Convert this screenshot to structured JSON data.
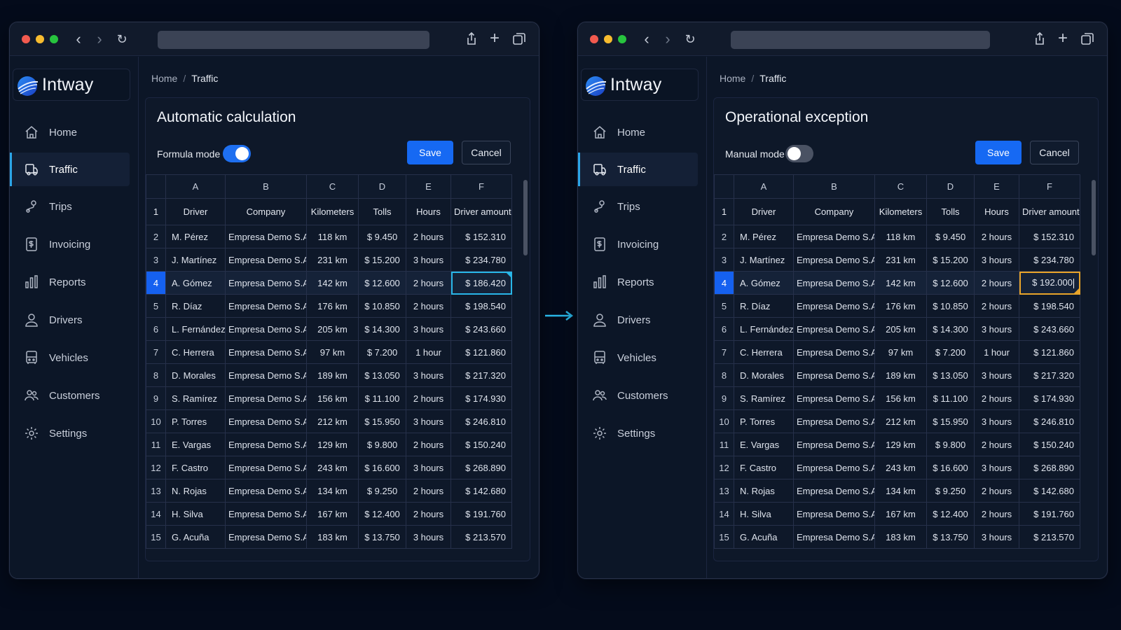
{
  "windows": [
    {
      "id": "left",
      "brand": "Intway",
      "breadcrumb": {
        "home": "Home",
        "current": "Traffic"
      },
      "menu": [
        {
          "label": "Home",
          "icon": "home-icon",
          "active": false
        },
        {
          "label": "Traffic",
          "icon": "truck-icon",
          "active": true
        },
        {
          "label": "Trips",
          "icon": "route-icon",
          "active": false
        },
        {
          "label": "Invoicing",
          "icon": "invoice-icon",
          "active": false
        },
        {
          "label": "Reports",
          "icon": "bar-chart-icon",
          "active": false
        },
        {
          "label": "Drivers",
          "icon": "user-icon",
          "active": false
        },
        {
          "label": "Vehicles",
          "icon": "vehicle-icon",
          "active": false
        },
        {
          "label": "Customers",
          "icon": "users-icon",
          "active": false
        },
        {
          "label": "Settings",
          "icon": "gear-icon",
          "active": false
        }
      ],
      "panel": {
        "title": "Automatic calculation",
        "mode_label": "Formula mode",
        "mode_on": true,
        "save_label": "Save",
        "cancel_label": "Cancel"
      },
      "sheet": {
        "columns": [
          "A",
          "B",
          "C",
          "D",
          "E",
          "F"
        ],
        "header_row_number": "1",
        "headers": [
          "Driver",
          "Company",
          "Kilometers",
          "Tolls",
          "Hours",
          "Driver amount"
        ],
        "active_row": 4,
        "rows": [
          {
            "n": "2",
            "driver": "M. Pérez",
            "company": "Empresa Demo S.A.",
            "km": "118 km",
            "tolls": "$ 9.450",
            "hours": "2 hours",
            "amount": "$ 152.310"
          },
          {
            "n": "3",
            "driver": "J. Martínez",
            "company": "Empresa Demo S.A.",
            "km": "231 km",
            "tolls": "$ 15.200",
            "hours": "3 hours",
            "amount": "$ 234.780"
          },
          {
            "n": "4",
            "driver": "A. Gómez",
            "company": "Empresa Demo S.A.",
            "km": "142 km",
            "tolls": "$ 12.600",
            "hours": "2 hours",
            "amount": "$ 186.420"
          },
          {
            "n": "5",
            "driver": "R. Díaz",
            "company": "Empresa Demo S.A.",
            "km": "176 km",
            "tolls": "$ 10.850",
            "hours": "2 hours",
            "amount": "$ 198.540"
          },
          {
            "n": "6",
            "driver": "L. Fernández",
            "company": "Empresa Demo S.A.",
            "km": "205 km",
            "tolls": "$ 14.300",
            "hours": "3 hours",
            "amount": "$ 243.660"
          },
          {
            "n": "7",
            "driver": "C. Herrera",
            "company": "Empresa Demo S.A.",
            "km": "97 km",
            "tolls": "$ 7.200",
            "hours": "1 hour",
            "amount": "$ 121.860"
          },
          {
            "n": "8",
            "driver": "D. Morales",
            "company": "Empresa Demo S.A.",
            "km": "189 km",
            "tolls": "$ 13.050",
            "hours": "3 hours",
            "amount": "$ 217.320"
          },
          {
            "n": "9",
            "driver": "S. Ramírez",
            "company": "Empresa Demo S.A.",
            "km": "156 km",
            "tolls": "$ 11.100",
            "hours": "2 hours",
            "amount": "$ 174.930"
          },
          {
            "n": "10",
            "driver": "P. Torres",
            "company": "Empresa Demo S.A.",
            "km": "212 km",
            "tolls": "$ 15.950",
            "hours": "3 hours",
            "amount": "$ 246.810"
          },
          {
            "n": "11",
            "driver": "E. Vargas",
            "company": "Empresa Demo S.A.",
            "km": "129 km",
            "tolls": "$ 9.800",
            "hours": "2 hours",
            "amount": "$ 150.240"
          },
          {
            "n": "12",
            "driver": "F. Castro",
            "company": "Empresa Demo S.A.",
            "km": "243 km",
            "tolls": "$ 16.600",
            "hours": "3 hours",
            "amount": "$ 268.890"
          },
          {
            "n": "13",
            "driver": "N. Rojas",
            "company": "Empresa Demo S.A.",
            "km": "134 km",
            "tolls": "$ 9.250",
            "hours": "2 hours",
            "amount": "$ 142.680"
          },
          {
            "n": "14",
            "driver": "H. Silva",
            "company": "Empresa Demo S.A.",
            "km": "167 km",
            "tolls": "$ 12.400",
            "hours": "2 hours",
            "amount": "$ 191.760"
          },
          {
            "n": "15",
            "driver": "G. Acuña",
            "company": "Empresa Demo S.A.",
            "km": "183 km",
            "tolls": "$ 13.750",
            "hours": "3 hours",
            "amount": "$ 213.570"
          }
        ]
      }
    },
    {
      "id": "right",
      "brand": "Intway",
      "breadcrumb": {
        "home": "Home",
        "current": "Traffic"
      },
      "menu": [
        {
          "label": "Home",
          "icon": "home-icon",
          "active": false
        },
        {
          "label": "Traffic",
          "icon": "truck-icon",
          "active": true
        },
        {
          "label": "Trips",
          "icon": "route-icon",
          "active": false
        },
        {
          "label": "Invoicing",
          "icon": "invoice-icon",
          "active": false
        },
        {
          "label": "Reports",
          "icon": "bar-chart-icon",
          "active": false
        },
        {
          "label": "Drivers",
          "icon": "user-icon",
          "active": false
        },
        {
          "label": "Vehicles",
          "icon": "vehicle-icon",
          "active": false
        },
        {
          "label": "Customers",
          "icon": "users-icon",
          "active": false
        },
        {
          "label": "Settings",
          "icon": "gear-icon",
          "active": false
        }
      ],
      "panel": {
        "title": "Operational exception",
        "mode_label": "Manual mode",
        "mode_on": false,
        "save_label": "Save",
        "cancel_label": "Cancel"
      },
      "sheet": {
        "columns": [
          "A",
          "B",
          "C",
          "D",
          "E",
          "F"
        ],
        "header_row_number": "1",
        "headers": [
          "Driver",
          "Company",
          "Kilometers",
          "Tolls",
          "Hours",
          "Driver amount"
        ],
        "active_row": 4,
        "rows": [
          {
            "n": "2",
            "driver": "M. Pérez",
            "company": "Empresa Demo S.A.",
            "km": "118 km",
            "tolls": "$ 9.450",
            "hours": "2 hours",
            "amount": "$ 152.310"
          },
          {
            "n": "3",
            "driver": "J. Martínez",
            "company": "Empresa Demo S.A.",
            "km": "231 km",
            "tolls": "$ 15.200",
            "hours": "3 hours",
            "amount": "$ 234.780"
          },
          {
            "n": "4",
            "driver": "A. Gómez",
            "company": "Empresa Demo S.A.",
            "km": "142 km",
            "tolls": "$ 12.600",
            "hours": "2 hours",
            "amount": "$ 192.000"
          },
          {
            "n": "5",
            "driver": "R. Díaz",
            "company": "Empresa Demo S.A.",
            "km": "176 km",
            "tolls": "$ 10.850",
            "hours": "2 hours",
            "amount": "$ 198.540"
          },
          {
            "n": "6",
            "driver": "L. Fernández",
            "company": "Empresa Demo S.A.",
            "km": "205 km",
            "tolls": "$ 14.300",
            "hours": "3 hours",
            "amount": "$ 243.660"
          },
          {
            "n": "7",
            "driver": "C. Herrera",
            "company": "Empresa Demo S.A.",
            "km": "97 km",
            "tolls": "$ 7.200",
            "hours": "1 hour",
            "amount": "$ 121.860"
          },
          {
            "n": "8",
            "driver": "D. Morales",
            "company": "Empresa Demo S.A.",
            "km": "189 km",
            "tolls": "$ 13.050",
            "hours": "3 hours",
            "amount": "$ 217.320"
          },
          {
            "n": "9",
            "driver": "S. Ramírez",
            "company": "Empresa Demo S.A.",
            "km": "156 km",
            "tolls": "$ 11.100",
            "hours": "2 hours",
            "amount": "$ 174.930"
          },
          {
            "n": "10",
            "driver": "P. Torres",
            "company": "Empresa Demo S.A.",
            "km": "212 km",
            "tolls": "$ 15.950",
            "hours": "3 hours",
            "amount": "$ 246.810"
          },
          {
            "n": "11",
            "driver": "E. Vargas",
            "company": "Empresa Demo S.A.",
            "km": "129 km",
            "tolls": "$ 9.800",
            "hours": "2 hours",
            "amount": "$ 150.240"
          },
          {
            "n": "12",
            "driver": "F. Castro",
            "company": "Empresa Demo S.A.",
            "km": "243 km",
            "tolls": "$ 16.600",
            "hours": "3 hours",
            "amount": "$ 268.890"
          },
          {
            "n": "13",
            "driver": "N. Rojas",
            "company": "Empresa Demo S.A.",
            "km": "134 km",
            "tolls": "$ 9.250",
            "hours": "2 hours",
            "amount": "$ 142.680"
          },
          {
            "n": "14",
            "driver": "H. Silva",
            "company": "Empresa Demo S.A.",
            "km": "167 km",
            "tolls": "$ 12.400",
            "hours": "2 hours",
            "amount": "$ 191.760"
          },
          {
            "n": "15",
            "driver": "G. Acuña",
            "company": "Empresa Demo S.A.",
            "km": "183 km",
            "tolls": "$ 13.750",
            "hours": "3 hours",
            "amount": "$ 213.570"
          }
        ]
      }
    }
  ],
  "colors": {
    "background": "#040b1b",
    "accent_blue": "#1669f3",
    "selection_cyan": "#29b6e8",
    "selection_orange": "#e8a42a",
    "transition_arrow": "#29b6e8"
  }
}
